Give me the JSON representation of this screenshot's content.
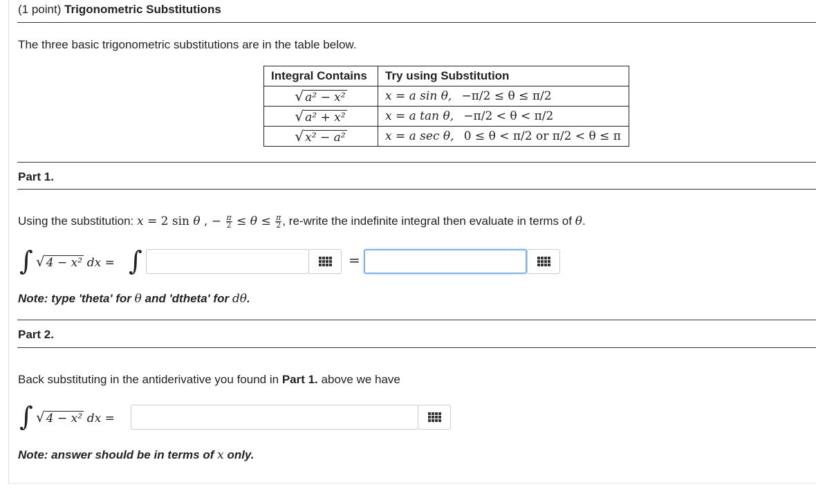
{
  "header": {
    "points": "(1 point)",
    "title": "Trigonometric Substitutions"
  },
  "intro": "The three basic trigonometric substitutions are in the table below.",
  "table": {
    "col1": "Integral Contains",
    "col2": "Try using Substitution",
    "rows": [
      {
        "contains": "a² − x²",
        "sub": "x = a sin θ,",
        "range": "−π/2 ≤ θ ≤ π/2"
      },
      {
        "contains": "a² + x²",
        "sub": "x = a tan θ,",
        "range": "−π/2 < θ < π/2"
      },
      {
        "contains": "x² − a²",
        "sub": "x = a sec θ,",
        "range": "0 ≤ θ < π/2 or π/2 < θ ≤ π"
      }
    ]
  },
  "part1": {
    "label": "Part 1.",
    "prompt_a": "Using the substitution:",
    "prompt_b": ", re-write the indefinite integral then evaluate in terms of",
    "integrand": "4 − x²",
    "dx": "dx =",
    "answer1": "",
    "answer2": "",
    "note_a": "Note: type 'theta' for",
    "note_b": "and 'dtheta' for",
    "note_c": "."
  },
  "part2": {
    "label": "Part 2.",
    "prompt_a": "Back substituting in the antiderivative you found in",
    "prompt_bold": "Part 1.",
    "prompt_b": "above we have",
    "integrand": "4 − x²",
    "dx": "dx =",
    "answer": "",
    "note_a": "Note: answer should be in terms of",
    "note_b": "only."
  },
  "icons": {
    "keyboard": "keypad-grid-icon"
  }
}
